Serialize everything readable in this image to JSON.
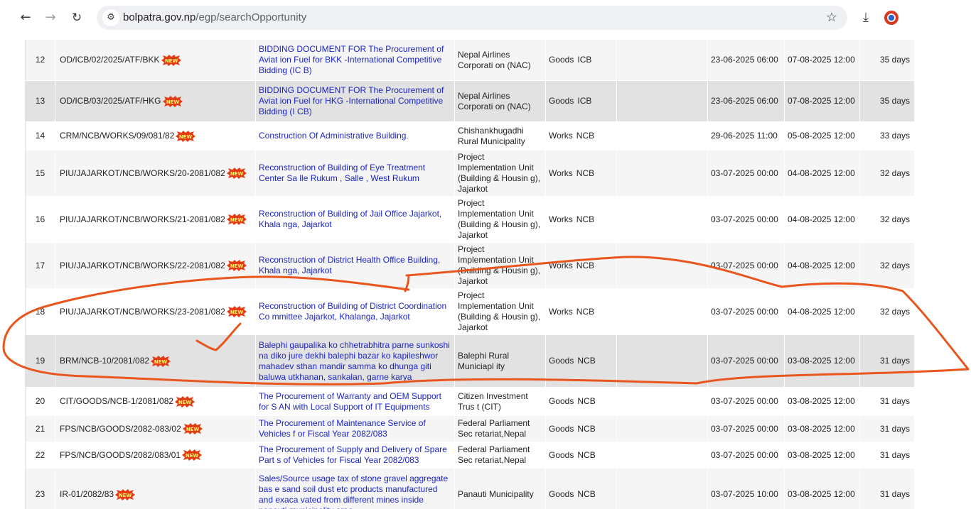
{
  "browser": {
    "url_host": "bolpatra.gov.np",
    "url_path": "/egp/searchOpportunity",
    "icons": [
      "back-arrow-icon",
      "forward-arrow-icon",
      "reload-icon",
      "site-info-icon",
      "bookmark-star-icon",
      "download-icon",
      "extension-icon"
    ]
  },
  "badge": {
    "label": "NEW",
    "color": "#e53b12"
  },
  "rows": [
    {
      "sn": "12",
      "ref": "OD/ICB/02/2025/ATF/BKK",
      "title": "BIDDING DOCUMENT FOR The Procurement of Aviat ion Fuel for BKK -International Competitive Bidding (IC B)",
      "entity": "Nepal Airlines Corporati on (NAC)",
      "type": "Goods",
      "method": "ICB",
      "published": "23-06-2025 06:00",
      "deadline": "07-08-2025 12:00",
      "days": "35 days"
    },
    {
      "sn": "13",
      "ref": "OD/ICB/03/2025/ATF/HKG",
      "title": "BIDDING DOCUMENT FOR The Procurement of Aviat ion Fuel for HKG -International Competitive Bidding (I CB)",
      "entity": "Nepal Airlines Corporati on (NAC)",
      "type": "Goods",
      "method": "ICB",
      "published": "23-06-2025 06:00",
      "deadline": "07-08-2025 12:00",
      "days": "35 days"
    },
    {
      "sn": "14",
      "ref": "CRM/NCB/WORKS/09/081/82",
      "title": "Construction Of Administrative Building.",
      "entity": "Chishankhugadhi Rural Municipality",
      "type": "Works",
      "method": "NCB",
      "published": "29-06-2025 11:00",
      "deadline": "05-08-2025 12:00",
      "days": "33 days"
    },
    {
      "sn": "15",
      "ref": "PIU/JAJARKOT/NCB/WORKS/20-2081/082",
      "title": "Reconstruction of Building of Eye Treatment Center Sa lle Rukum , Salle , West Rukum",
      "entity": "Project Implementation Unit (Building & Housin g), Jajarkot",
      "type": "Works",
      "method": "NCB",
      "published": "03-07-2025 00:00",
      "deadline": "04-08-2025 12:00",
      "days": "32 days"
    },
    {
      "sn": "16",
      "ref": "PIU/JAJARKOT/NCB/WORKS/21-2081/082",
      "title": "Reconstruction of Building of Jail Office Jajarkot, Khala nga, Jajarkot",
      "entity": "Project Implementation Unit (Building & Housin g), Jajarkot",
      "type": "Works",
      "method": "NCB",
      "published": "03-07-2025 00:00",
      "deadline": "04-08-2025 12:00",
      "days": "32 days"
    },
    {
      "sn": "17",
      "ref": "PIU/JAJARKOT/NCB/WORKS/22-2081/082",
      "title": "Reconstruction of District Health Office Building, Khala nga, Jajarkot",
      "entity": "Project Implementation Unit (Building & Housin g), Jajarkot",
      "type": "Works",
      "method": "NCB",
      "published": "03-07-2025 00:00",
      "deadline": "04-08-2025 12:00",
      "days": "32 days"
    },
    {
      "sn": "18",
      "ref": "PIU/JAJARKOT/NCB/WORKS/23-2081/082",
      "title": "Reconstruction of Building of District Coordination Co mmittee Jajarkot, Khalanga, Jajarkot",
      "entity": "Project Implementation Unit (Building & Housin g), Jajarkot",
      "type": "Works",
      "method": "NCB",
      "published": "03-07-2025 00:00",
      "deadline": "04-08-2025 12:00",
      "days": "32 days"
    },
    {
      "sn": "19",
      "ref": "BRM/NCB-10/2081/082",
      "title": "Balephi gaupalika ko chhetrabhitra parne sunkoshi na diko jure dekhi balephi bazar ko kapileshwor mahadev sthan mandir samma ko dhunga giti baluwa utkhanan, sankalan, garne karya",
      "entity": "Balephi Rural Municiapl ity",
      "type": "Goods",
      "method": "NCB",
      "published": "03-07-2025 00:00",
      "deadline": "03-08-2025 12:00",
      "days": "31 days"
    },
    {
      "sn": "20",
      "ref": "CIT/GOODS/NCB-1/2081/082",
      "title": "The Procurement of Warranty and OEM Support for S AN with Local Support of IT Equipments",
      "entity": "Citizen Investment Trus t (CIT)",
      "type": "Goods",
      "method": "NCB",
      "published": "03-07-2025 00:00",
      "deadline": "03-08-2025 12:00",
      "days": "31 days"
    },
    {
      "sn": "21",
      "ref": "FPS/NCB/GOODS/2082-083/02",
      "title": "The Procurement of Maintenance Service of Vehicles f or Fiscal Year 2082/083",
      "entity": "Federal Parliament Sec retariat,Nepal",
      "type": "Goods",
      "method": "NCB",
      "published": "03-07-2025 00:00",
      "deadline": "03-08-2025 12:00",
      "days": "31 days"
    },
    {
      "sn": "22",
      "ref": "FPS/NCB/GOODS/2082/083/01",
      "title": "The Procurement of Supply and Delivery of Spare Part s of Vehicles for Fiscal Year 2082/083",
      "entity": "Federal Parliament Sec retariat,Nepal",
      "type": "Goods",
      "method": "NCB",
      "published": "03-07-2025 00:00",
      "deadline": "03-08-2025 12:00",
      "days": "31 days"
    },
    {
      "sn": "23",
      "ref": "IR-01/2082/83",
      "title": "Sales/Source usage tax of stone gravel aggregate bas e sand soil dust etc products manufactured and exaca vated from different mines inside panauti municipality area",
      "entity": "Panauti Municipality",
      "type": "Goods",
      "method": "NCB",
      "published": "03-07-2025 10:00",
      "deadline": "03-08-2025 12:00",
      "days": "31 days"
    }
  ],
  "annotation": {
    "color": "#e8561e",
    "marks": [
      "hand-drawn-ellipse",
      "checkmark"
    ]
  }
}
